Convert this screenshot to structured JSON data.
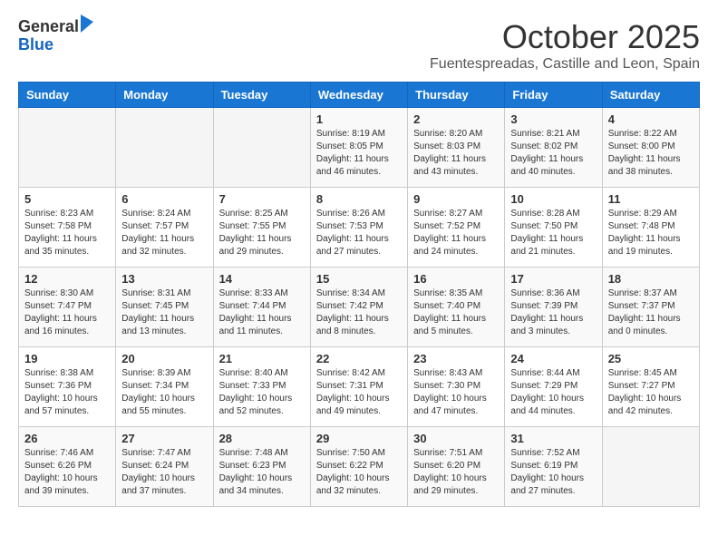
{
  "header": {
    "logo_general": "General",
    "logo_blue": "Blue",
    "month_title": "October 2025",
    "subtitle": "Fuentespreadas, Castille and Leon, Spain"
  },
  "calendar": {
    "days_of_week": [
      "Sunday",
      "Monday",
      "Tuesday",
      "Wednesday",
      "Thursday",
      "Friday",
      "Saturday"
    ],
    "weeks": [
      [
        {
          "day": "",
          "info": ""
        },
        {
          "day": "",
          "info": ""
        },
        {
          "day": "",
          "info": ""
        },
        {
          "day": "1",
          "info": "Sunrise: 8:19 AM\nSunset: 8:05 PM\nDaylight: 11 hours\nand 46 minutes."
        },
        {
          "day": "2",
          "info": "Sunrise: 8:20 AM\nSunset: 8:03 PM\nDaylight: 11 hours\nand 43 minutes."
        },
        {
          "day": "3",
          "info": "Sunrise: 8:21 AM\nSunset: 8:02 PM\nDaylight: 11 hours\nand 40 minutes."
        },
        {
          "day": "4",
          "info": "Sunrise: 8:22 AM\nSunset: 8:00 PM\nDaylight: 11 hours\nand 38 minutes."
        }
      ],
      [
        {
          "day": "5",
          "info": "Sunrise: 8:23 AM\nSunset: 7:58 PM\nDaylight: 11 hours\nand 35 minutes."
        },
        {
          "day": "6",
          "info": "Sunrise: 8:24 AM\nSunset: 7:57 PM\nDaylight: 11 hours\nand 32 minutes."
        },
        {
          "day": "7",
          "info": "Sunrise: 8:25 AM\nSunset: 7:55 PM\nDaylight: 11 hours\nand 29 minutes."
        },
        {
          "day": "8",
          "info": "Sunrise: 8:26 AM\nSunset: 7:53 PM\nDaylight: 11 hours\nand 27 minutes."
        },
        {
          "day": "9",
          "info": "Sunrise: 8:27 AM\nSunset: 7:52 PM\nDaylight: 11 hours\nand 24 minutes."
        },
        {
          "day": "10",
          "info": "Sunrise: 8:28 AM\nSunset: 7:50 PM\nDaylight: 11 hours\nand 21 minutes."
        },
        {
          "day": "11",
          "info": "Sunrise: 8:29 AM\nSunset: 7:48 PM\nDaylight: 11 hours\nand 19 minutes."
        }
      ],
      [
        {
          "day": "12",
          "info": "Sunrise: 8:30 AM\nSunset: 7:47 PM\nDaylight: 11 hours\nand 16 minutes."
        },
        {
          "day": "13",
          "info": "Sunrise: 8:31 AM\nSunset: 7:45 PM\nDaylight: 11 hours\nand 13 minutes."
        },
        {
          "day": "14",
          "info": "Sunrise: 8:33 AM\nSunset: 7:44 PM\nDaylight: 11 hours\nand 11 minutes."
        },
        {
          "day": "15",
          "info": "Sunrise: 8:34 AM\nSunset: 7:42 PM\nDaylight: 11 hours\nand 8 minutes."
        },
        {
          "day": "16",
          "info": "Sunrise: 8:35 AM\nSunset: 7:40 PM\nDaylight: 11 hours\nand 5 minutes."
        },
        {
          "day": "17",
          "info": "Sunrise: 8:36 AM\nSunset: 7:39 PM\nDaylight: 11 hours\nand 3 minutes."
        },
        {
          "day": "18",
          "info": "Sunrise: 8:37 AM\nSunset: 7:37 PM\nDaylight: 11 hours\nand 0 minutes."
        }
      ],
      [
        {
          "day": "19",
          "info": "Sunrise: 8:38 AM\nSunset: 7:36 PM\nDaylight: 10 hours\nand 57 minutes."
        },
        {
          "day": "20",
          "info": "Sunrise: 8:39 AM\nSunset: 7:34 PM\nDaylight: 10 hours\nand 55 minutes."
        },
        {
          "day": "21",
          "info": "Sunrise: 8:40 AM\nSunset: 7:33 PM\nDaylight: 10 hours\nand 52 minutes."
        },
        {
          "day": "22",
          "info": "Sunrise: 8:42 AM\nSunset: 7:31 PM\nDaylight: 10 hours\nand 49 minutes."
        },
        {
          "day": "23",
          "info": "Sunrise: 8:43 AM\nSunset: 7:30 PM\nDaylight: 10 hours\nand 47 minutes."
        },
        {
          "day": "24",
          "info": "Sunrise: 8:44 AM\nSunset: 7:29 PM\nDaylight: 10 hours\nand 44 minutes."
        },
        {
          "day": "25",
          "info": "Sunrise: 8:45 AM\nSunset: 7:27 PM\nDaylight: 10 hours\nand 42 minutes."
        }
      ],
      [
        {
          "day": "26",
          "info": "Sunrise: 7:46 AM\nSunset: 6:26 PM\nDaylight: 10 hours\nand 39 minutes."
        },
        {
          "day": "27",
          "info": "Sunrise: 7:47 AM\nSunset: 6:24 PM\nDaylight: 10 hours\nand 37 minutes."
        },
        {
          "day": "28",
          "info": "Sunrise: 7:48 AM\nSunset: 6:23 PM\nDaylight: 10 hours\nand 34 minutes."
        },
        {
          "day": "29",
          "info": "Sunrise: 7:50 AM\nSunset: 6:22 PM\nDaylight: 10 hours\nand 32 minutes."
        },
        {
          "day": "30",
          "info": "Sunrise: 7:51 AM\nSunset: 6:20 PM\nDaylight: 10 hours\nand 29 minutes."
        },
        {
          "day": "31",
          "info": "Sunrise: 7:52 AM\nSunset: 6:19 PM\nDaylight: 10 hours\nand 27 minutes."
        },
        {
          "day": "",
          "info": ""
        }
      ]
    ]
  }
}
